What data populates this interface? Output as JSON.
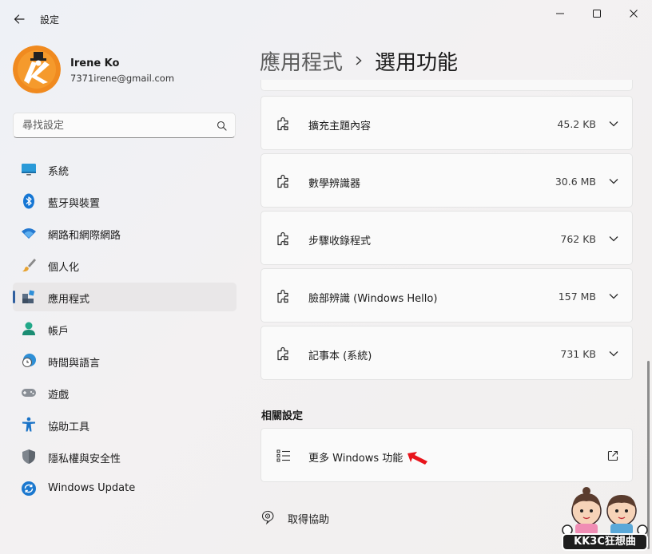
{
  "window": {
    "title": "設定"
  },
  "profile": {
    "name": "Irene Ko",
    "email": "7371irene@gmail.com"
  },
  "search": {
    "placeholder": "尋找設定"
  },
  "sidebar": {
    "items": [
      {
        "label": "系統",
        "icon": "system-icon",
        "selected": false
      },
      {
        "label": "藍牙與裝置",
        "icon": "bluetooth-icon",
        "selected": false
      },
      {
        "label": "網路和網際網路",
        "icon": "wifi-icon",
        "selected": false
      },
      {
        "label": "個人化",
        "icon": "brush-icon",
        "selected": false
      },
      {
        "label": "應用程式",
        "icon": "apps-icon",
        "selected": true
      },
      {
        "label": "帳戶",
        "icon": "account-icon",
        "selected": false
      },
      {
        "label": "時間與語言",
        "icon": "time-language-icon",
        "selected": false
      },
      {
        "label": "遊戲",
        "icon": "gamepad-icon",
        "selected": false
      },
      {
        "label": "協助工具",
        "icon": "accessibility-icon",
        "selected": false
      },
      {
        "label": "隱私權與安全性",
        "icon": "shield-icon",
        "selected": false
      },
      {
        "label": "Windows Update",
        "icon": "windows-update-icon",
        "selected": false
      }
    ]
  },
  "breadcrumb": {
    "parent": "應用程式",
    "current": "選用功能"
  },
  "features": [
    {
      "name": "擴充主題內容",
      "size": "45.2 KB"
    },
    {
      "name": "數學辨識器",
      "size": "30.6 MB"
    },
    {
      "name": "步驟收錄程式",
      "size": "762 KB"
    },
    {
      "name": "臉部辨識 (Windows Hello)",
      "size": "157 MB"
    },
    {
      "name": "記事本 (系統)",
      "size": "731 KB"
    }
  ],
  "related": {
    "title": "相關設定",
    "more_windows_features": "更多 Windows 功能"
  },
  "help": {
    "label": "取得協助"
  },
  "watermark": {
    "text": "KK3C狂想曲"
  },
  "colors": {
    "accent": "#2f5f9f",
    "annotation_arrow": "#e8141b"
  }
}
